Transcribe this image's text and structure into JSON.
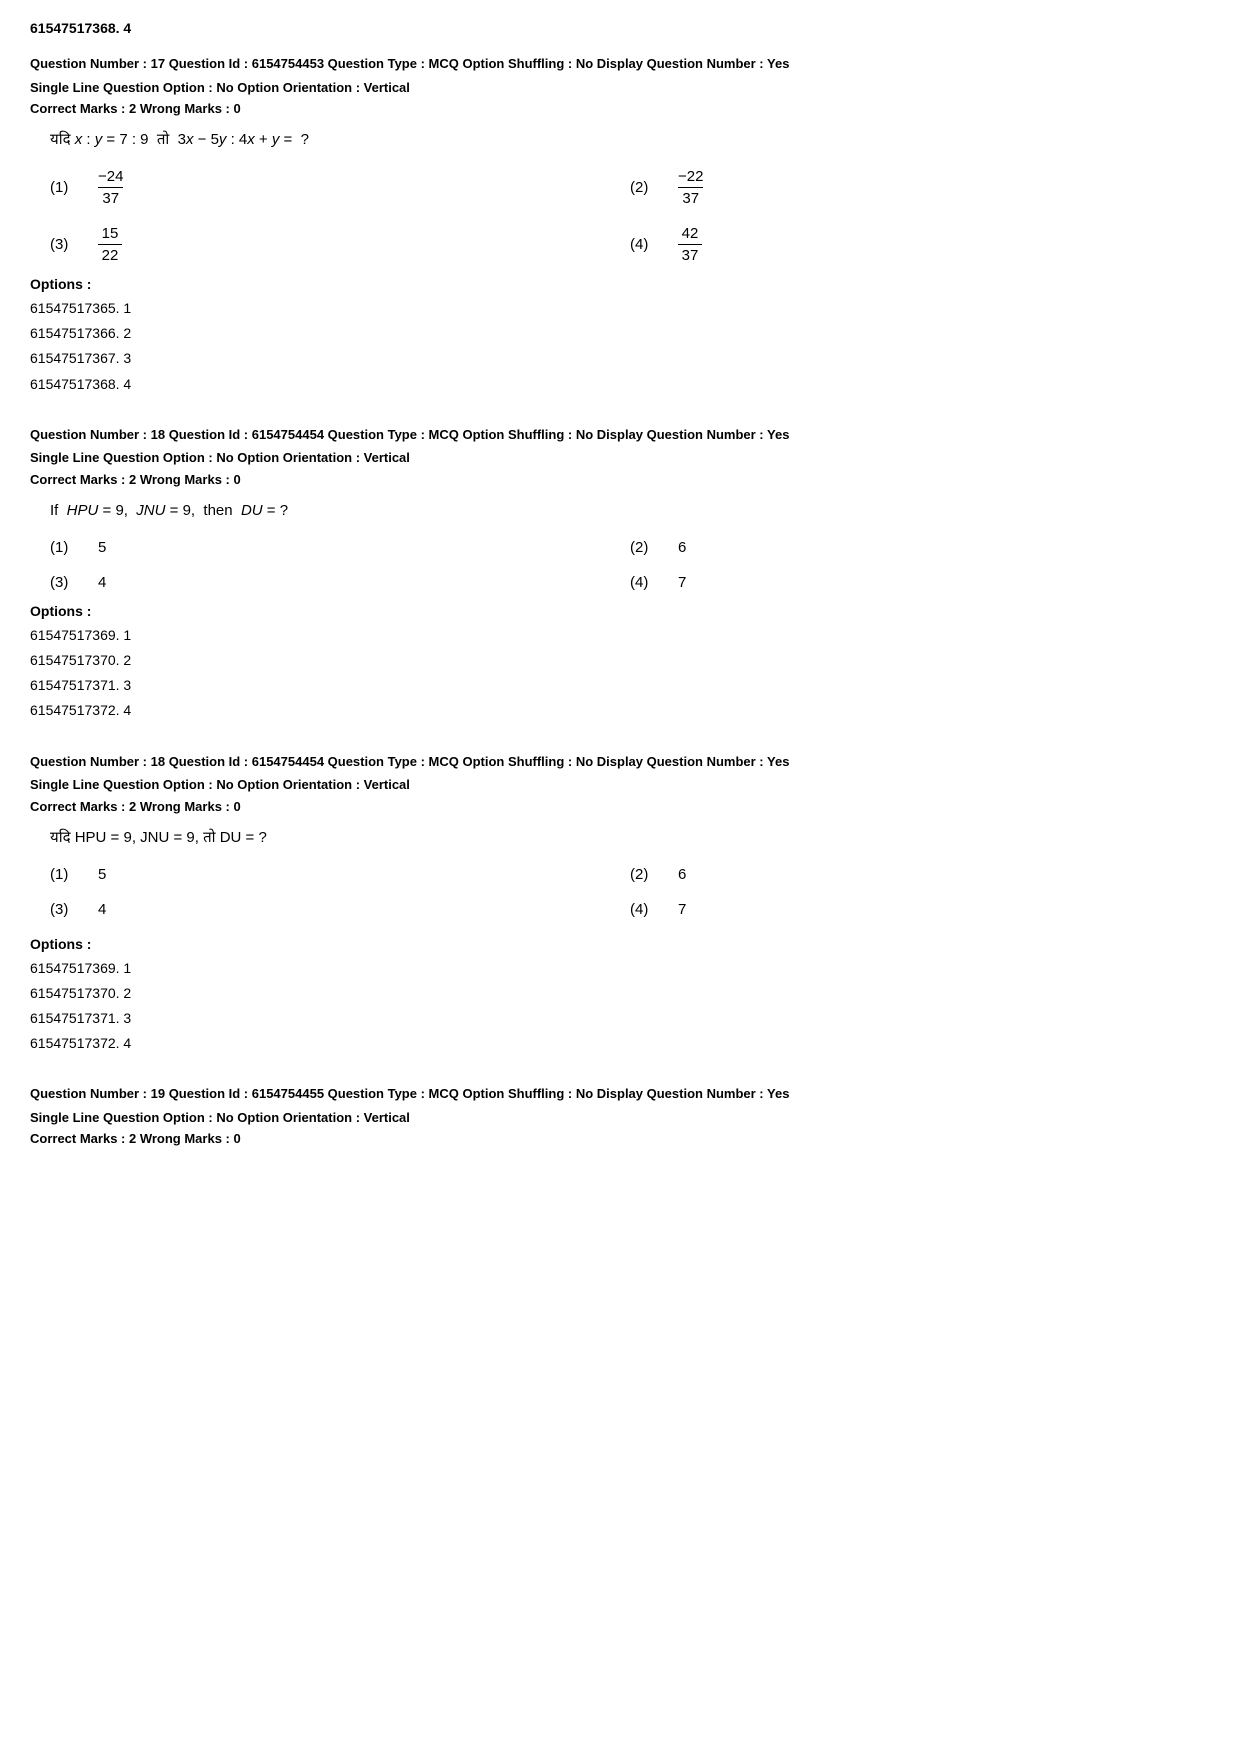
{
  "page": {
    "header": "61547517368. 4"
  },
  "questions": [
    {
      "id": "q17",
      "meta_line1": "Question Number : 17  Question Id : 6154754453  Question Type : MCQ  Option Shuffling : No  Display Question Number : Yes",
      "meta_line2": "Single Line Question Option : No  Option Orientation : Vertical",
      "marks": "Correct Marks : 2  Wrong Marks : 0",
      "question_type": "fraction_hindi",
      "question_text_hindi": "यदि x : y = 7 : 9 तो 3x − 5y : 4x + y = ?",
      "options": [
        {
          "num": "(1)",
          "value": "fraction",
          "numerator": "−24",
          "denominator": "37"
        },
        {
          "num": "(2)",
          "value": "fraction",
          "numerator": "−22",
          "denominator": "37"
        },
        {
          "num": "(3)",
          "value": "fraction",
          "numerator": "15",
          "denominator": "22"
        },
        {
          "num": "(4)",
          "value": "fraction",
          "numerator": "42",
          "denominator": "37"
        }
      ],
      "options_label": "Options :",
      "options_list": [
        "61547517365. 1",
        "61547517366. 2",
        "61547517367. 3",
        "61547517368. 4"
      ]
    },
    {
      "id": "q18a",
      "meta_line1": "Question Number : 18  Question Id : 6154754454  Question Type : MCQ  Option Shuffling : No  Display Question Number : Yes",
      "meta_line2": "Single Line Question Option : No  Option Orientation : Vertical",
      "marks": "Correct Marks : 2  Wrong Marks : 0",
      "question_type": "english",
      "question_text_eng": "If  HPU = 9,  JNU = 9,  then  DU = ?",
      "options_simple": [
        {
          "num": "(1)",
          "value": "5",
          "col": 1
        },
        {
          "num": "(2)",
          "value": "6",
          "col": 2
        },
        {
          "num": "(3)",
          "value": "4",
          "col": 1
        },
        {
          "num": "(4)",
          "value": "7",
          "col": 2
        }
      ],
      "options_label": "Options :",
      "options_list": [
        "61547517369. 1",
        "61547517370. 2",
        "61547517371. 3",
        "61547517372. 4"
      ]
    },
    {
      "id": "q18b",
      "meta_line1": "Question Number : 18  Question Id : 6154754454  Question Type : MCQ  Option Shuffling : No  Display Question Number : Yes",
      "meta_line2": "Single Line Question Option : No  Option Orientation : Vertical",
      "marks": "Correct Marks : 2  Wrong Marks : 0",
      "question_type": "hindi",
      "question_text_hindi": "यदि HPU = 9, JNU = 9, तो DU = ?",
      "options_simple": [
        {
          "num": "(1)",
          "value": "5",
          "col": 1
        },
        {
          "num": "(2)",
          "value": "6",
          "col": 2
        },
        {
          "num": "(3)",
          "value": "4",
          "col": 1
        },
        {
          "num": "(4)",
          "value": "7",
          "col": 2
        }
      ],
      "options_label": "Options :",
      "options_list": [
        "61547517369. 1",
        "61547517370. 2",
        "61547517371. 3",
        "61547517372. 4"
      ]
    },
    {
      "id": "q19",
      "meta_line1": "Question Number : 19  Question Id : 6154754455  Question Type : MCQ  Option Shuffling : No  Display Question Number : Yes",
      "meta_line2": "Single Line Question Option : No  Option Orientation : Vertical",
      "marks": "Correct Marks : 2  Wrong Marks : 0"
    }
  ]
}
